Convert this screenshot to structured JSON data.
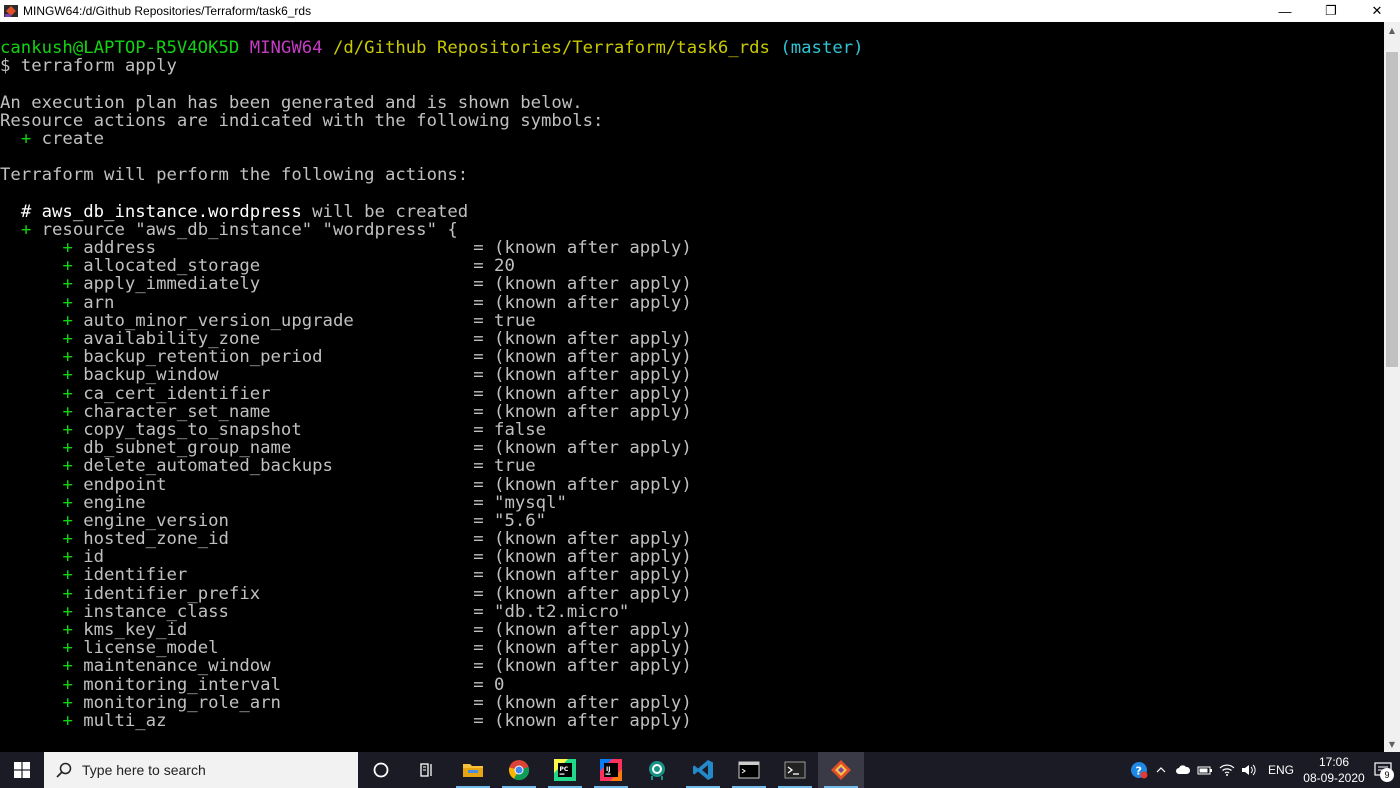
{
  "window": {
    "title": "MINGW64:/d/Github Repositories/Terraform/task6_rds",
    "minimize": "—",
    "maximize": "❐",
    "close": "✕"
  },
  "terminal": {
    "prompt": {
      "user_host": "cankush@LAPTOP-R5V4OK5D",
      "env": "MINGW64",
      "path": "/d/Github Repositories/Terraform/task6_rds",
      "branch": "(master)"
    },
    "command": "$ terraform apply",
    "intro": [
      "An execution plan has been generated and is shown below.",
      "Resource actions are indicated with the following symbols:"
    ],
    "symbol_plus": "+",
    "symbol_create": "create",
    "perform": "Terraform will perform the following actions:",
    "comment_hash": "#",
    "resource_name": "aws_db_instance.wordpress",
    "will_be_created": "will be created",
    "resource_decl": "resource \"aws_db_instance\" \"wordpress\" {",
    "attributes": [
      {
        "name": "address",
        "value": "= (known after apply)"
      },
      {
        "name": "allocated_storage",
        "value": "= 20"
      },
      {
        "name": "apply_immediately",
        "value": "= (known after apply)"
      },
      {
        "name": "arn",
        "value": "= (known after apply)"
      },
      {
        "name": "auto_minor_version_upgrade",
        "value": "= true"
      },
      {
        "name": "availability_zone",
        "value": "= (known after apply)"
      },
      {
        "name": "backup_retention_period",
        "value": "= (known after apply)"
      },
      {
        "name": "backup_window",
        "value": "= (known after apply)"
      },
      {
        "name": "ca_cert_identifier",
        "value": "= (known after apply)"
      },
      {
        "name": "character_set_name",
        "value": "= (known after apply)"
      },
      {
        "name": "copy_tags_to_snapshot",
        "value": "= false"
      },
      {
        "name": "db_subnet_group_name",
        "value": "= (known after apply)"
      },
      {
        "name": "delete_automated_backups",
        "value": "= true"
      },
      {
        "name": "endpoint",
        "value": "= (known after apply)"
      },
      {
        "name": "engine",
        "value": "= \"mysql\""
      },
      {
        "name": "engine_version",
        "value": "= \"5.6\""
      },
      {
        "name": "hosted_zone_id",
        "value": "= (known after apply)"
      },
      {
        "name": "id",
        "value": "= (known after apply)"
      },
      {
        "name": "identifier",
        "value": "= (known after apply)"
      },
      {
        "name": "identifier_prefix",
        "value": "= (known after apply)"
      },
      {
        "name": "instance_class",
        "value": "= \"db.t2.micro\""
      },
      {
        "name": "kms_key_id",
        "value": "= (known after apply)"
      },
      {
        "name": "license_model",
        "value": "= (known after apply)"
      },
      {
        "name": "maintenance_window",
        "value": "= (known after apply)"
      },
      {
        "name": "monitoring_interval",
        "value": "= 0"
      },
      {
        "name": "monitoring_role_arn",
        "value": "= (known after apply)"
      },
      {
        "name": "multi_az",
        "value": "= (known after apply)"
      }
    ]
  },
  "taskbar": {
    "search_placeholder": "Type here to search",
    "apps": [
      {
        "icon": "task-view-icon"
      },
      {
        "icon": "widgets-icon"
      },
      {
        "icon": "file-explorer-icon"
      },
      {
        "icon": "chrome-icon"
      },
      {
        "icon": "pycharm-icon"
      },
      {
        "icon": "intellij-icon"
      },
      {
        "icon": "gitkraken-icon"
      },
      {
        "icon": "vscode-icon"
      },
      {
        "icon": "terminal-icon"
      },
      {
        "icon": "powershell-icon"
      },
      {
        "icon": "git-bash-icon"
      }
    ],
    "lang": "ENG",
    "time": "17:06",
    "date": "08-09-2020",
    "notification_count": "9"
  },
  "colors": {
    "terminal_bg": "#000000",
    "terminal_fg": "#c0c0c0",
    "green": "#12d312",
    "magenta": "#c43cc4",
    "yellow": "#c9c900",
    "cyan": "#2ec4d4",
    "taskbar_bg": "#1b1b25"
  }
}
